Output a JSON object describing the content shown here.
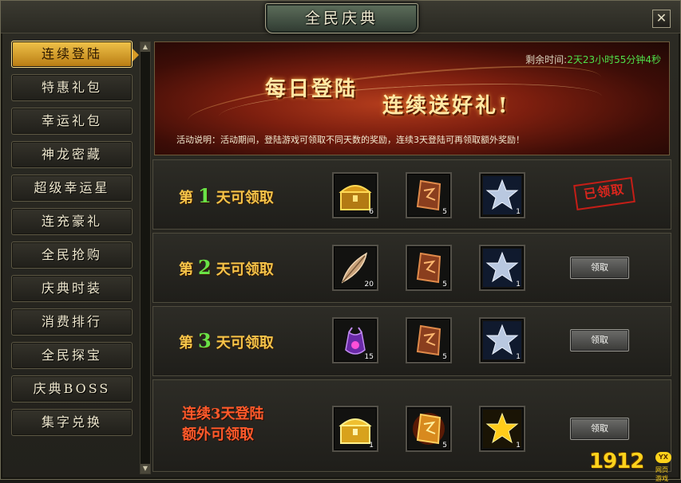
{
  "window": {
    "title": "全民庆典",
    "close_symbol": "✕"
  },
  "sidebar": {
    "items": [
      {
        "label": "连续登陆",
        "active": true
      },
      {
        "label": "特惠礼包"
      },
      {
        "label": "幸运礼包"
      },
      {
        "label": "神龙密藏"
      },
      {
        "label": "超级幸运星"
      },
      {
        "label": "连充豪礼"
      },
      {
        "label": "全民抢购"
      },
      {
        "label": "庆典时装"
      },
      {
        "label": "消费排行"
      },
      {
        "label": "全民探宝"
      },
      {
        "label": "庆典BOSS"
      },
      {
        "label": "集字兑换"
      }
    ]
  },
  "scrollbar": {
    "up": "▲",
    "down": "▼"
  },
  "banner": {
    "timer_label": "剩余时间:",
    "timer_value": "2天23小时55分钟4秒",
    "title_1": "每日登陆",
    "title_2": "连续送好礼!",
    "description": "活动说明：活动期间，登陆游戏可领取不同天数的奖励，连续3天登陆可再领取额外奖励！"
  },
  "rows": [
    {
      "prefix": "第",
      "day": "1",
      "suffix": "天可领取",
      "status": "已领取",
      "items": [
        {
          "icon": "treasure-chest-icon",
          "count": "6"
        },
        {
          "icon": "rune-stone-icon",
          "count": "5"
        },
        {
          "icon": "silver-star-icon",
          "count": "1"
        }
      ]
    },
    {
      "prefix": "第",
      "day": "2",
      "suffix": "天可领取",
      "button": "领取",
      "items": [
        {
          "icon": "feather-icon",
          "count": "20"
        },
        {
          "icon": "rune-stone-icon",
          "count": "5"
        },
        {
          "icon": "silver-star-icon",
          "count": "1"
        }
      ]
    },
    {
      "prefix": "第",
      "day": "3",
      "suffix": "天可领取",
      "button": "领取",
      "items": [
        {
          "icon": "purple-pouch-icon",
          "count": "15"
        },
        {
          "icon": "rune-stone-icon",
          "count": "5"
        },
        {
          "icon": "silver-star-icon",
          "count": "1"
        }
      ]
    },
    {
      "bonus_line1": "连续3天登陆",
      "bonus_line2": "额外可领取",
      "button": "领取",
      "items": [
        {
          "icon": "gold-chest-icon",
          "count": "1"
        },
        {
          "icon": "golden-rune-icon",
          "count": "5"
        },
        {
          "icon": "gold-star-icon",
          "count": "1"
        }
      ]
    }
  ],
  "logo": {
    "number": "1912",
    "badge": "YX",
    "sub": "网页游戏"
  },
  "colors": {
    "accent_gold": "#f6c449",
    "day_green": "#69e247",
    "bonus_red": "#ff5a2b",
    "timer_green": "#4fe04a",
    "stamp_red": "#d8261d"
  }
}
